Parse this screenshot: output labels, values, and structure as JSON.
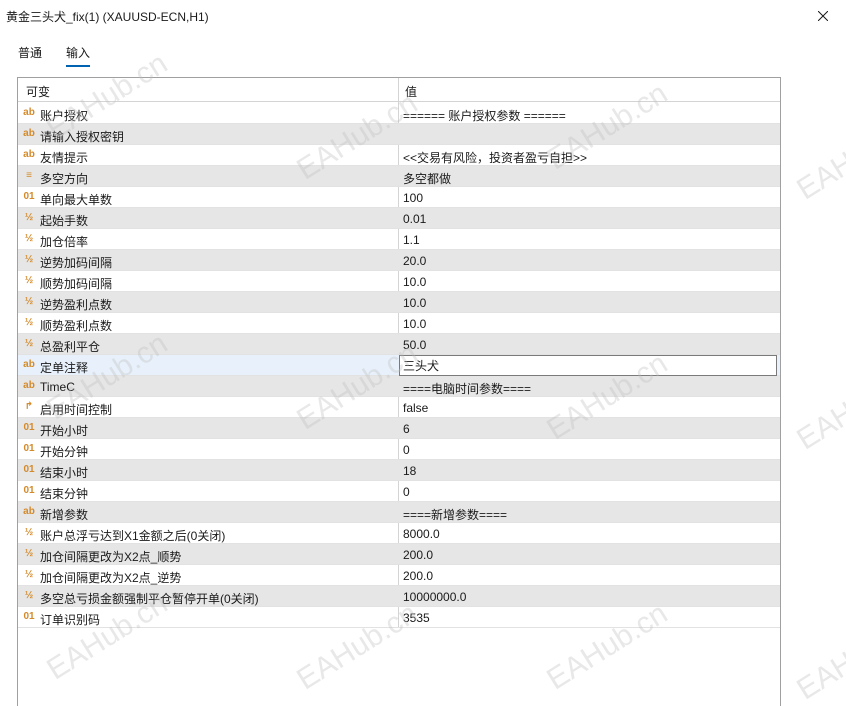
{
  "window": {
    "title": "黄金三头犬_fix(1) (XAUUSD-ECN,H1)"
  },
  "tabs": [
    {
      "label": "普通",
      "active": false
    },
    {
      "label": "输入",
      "active": true
    }
  ],
  "grid": {
    "col_variable": "可变",
    "col_value": "值",
    "rows": [
      {
        "type": "ab",
        "name": "账户授权",
        "value": "====== 账户授权参数 ======"
      },
      {
        "type": "ab",
        "name": "请输入授权密钥",
        "value": ""
      },
      {
        "type": "ab",
        "name": "友情提示",
        "value": "<<交易有风险，投资者盈亏自担>>"
      },
      {
        "type": "enum",
        "name": "多空方向",
        "value": "多空都做"
      },
      {
        "type": "01",
        "name": "单向最大单数",
        "value": "100"
      },
      {
        "type": "half",
        "name": "起始手数",
        "value": "0.01"
      },
      {
        "type": "half",
        "name": "加仓倍率",
        "value": "1.1"
      },
      {
        "type": "half",
        "name": "逆势加码间隔",
        "value": "20.0"
      },
      {
        "type": "half",
        "name": "顺势加码间隔",
        "value": "10.0"
      },
      {
        "type": "half",
        "name": "逆势盈利点数",
        "value": "10.0"
      },
      {
        "type": "half",
        "name": "顺势盈利点数",
        "value": "10.0"
      },
      {
        "type": "half",
        "name": "总盈利平仓",
        "value": "50.0"
      },
      {
        "type": "ab",
        "name": "定单注释",
        "value": "三头犬",
        "editing": true
      },
      {
        "type": "ab",
        "name": "TimeC",
        "value": "====电脑时间参数===="
      },
      {
        "type": "bool",
        "name": "启用时间控制",
        "value": "false"
      },
      {
        "type": "01",
        "name": "开始小时",
        "value": "6"
      },
      {
        "type": "01",
        "name": "开始分钟",
        "value": "0"
      },
      {
        "type": "01",
        "name": "结束小时",
        "value": "18"
      },
      {
        "type": "01",
        "name": "结束分钟",
        "value": "0"
      },
      {
        "type": "ab",
        "name": "新增参数",
        "value": "====新增参数===="
      },
      {
        "type": "half",
        "name": "账户总浮亏达到X1金额之后(0关闭)",
        "value": "8000.0"
      },
      {
        "type": "half",
        "name": "加仓间隔更改为X2点_顺势",
        "value": "200.0"
      },
      {
        "type": "half",
        "name": "加仓间隔更改为X2点_逆势",
        "value": "200.0"
      },
      {
        "type": "half",
        "name": "多空总亏损金额强制平仓暂停开单(0关闭)",
        "value": "10000000.0"
      },
      {
        "type": "01",
        "name": "订单识别码",
        "value": "3535"
      }
    ]
  },
  "icons": {
    "ab": "ab",
    "01": "01",
    "half": "½",
    "enum": "≡",
    "bool": "↱"
  },
  "watermark": "EAHub.cn",
  "colors": {
    "accent": "#0063b1",
    "alt_row": "#e6e6e6",
    "icon_orange": "#d48a2a",
    "icon_blue": "#3a78c2",
    "icon_green": "#2f9e44"
  }
}
